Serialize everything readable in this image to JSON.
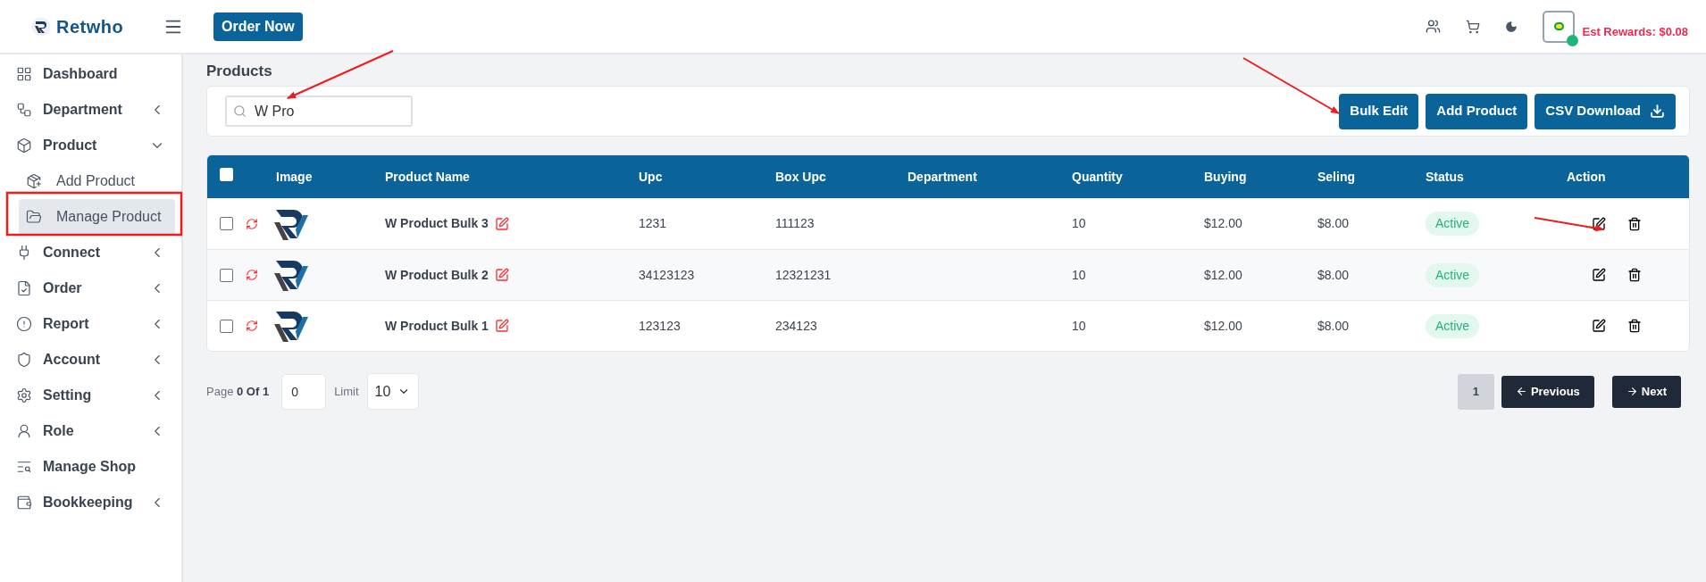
{
  "header": {
    "brand": "Retwho",
    "order_button": "Order Now",
    "rewards": "Est Rewards: $0.08",
    "online": true
  },
  "sidebar": {
    "items": [
      {
        "label": "Dashboard",
        "selected": false
      },
      {
        "label": "Department",
        "selected": false,
        "expanded": false
      },
      {
        "label": "Product",
        "selected": false,
        "expanded": true,
        "children": [
          {
            "label": "Add Product",
            "selected": false
          },
          {
            "label": "Manage Product",
            "selected": true
          }
        ]
      },
      {
        "label": "Connect",
        "selected": false,
        "expanded": false
      },
      {
        "label": "Order",
        "selected": false,
        "expanded": false
      },
      {
        "label": "Report",
        "selected": false,
        "expanded": false
      },
      {
        "label": "Account",
        "selected": false,
        "expanded": false
      },
      {
        "label": "Setting",
        "selected": false,
        "expanded": false
      },
      {
        "label": "Role",
        "selected": false,
        "expanded": false
      },
      {
        "label": "Manage Shop",
        "selected": false
      },
      {
        "label": "Bookkeeping",
        "selected": false,
        "expanded": false
      }
    ]
  },
  "page": {
    "title": "Products"
  },
  "toolbar": {
    "search": {
      "value": "W Pro"
    },
    "buttons": [
      "Bulk Edit",
      "Add Product",
      "CSV Download"
    ]
  },
  "table": {
    "header_checked": false,
    "columns": [
      "Image",
      "Product Name",
      "Upc",
      "Box Upc",
      "Department",
      "Quantity",
      "Buying",
      "Seling",
      "Status",
      "Action"
    ],
    "rows": [
      {
        "checked": false,
        "name": "W Product Bulk 3",
        "upc": "1231",
        "box_upc": "111123",
        "quantity": "10",
        "buying": "$12.00",
        "selling": "$8.00",
        "status": "Active"
      },
      {
        "checked": false,
        "name": "W Product Bulk 2",
        "upc": "34123123",
        "box_upc": "12321231",
        "quantity": "10",
        "buying": "$12.00",
        "selling": "$8.00",
        "status": "Active"
      },
      {
        "checked": false,
        "name": "W Product Bulk 1",
        "upc": "123123",
        "box_upc": "234123",
        "quantity": "10",
        "buying": "$12.00",
        "selling": "$8.00",
        "status": "Active"
      }
    ]
  },
  "pagination": {
    "page_label": "Page",
    "page_info": "0 Of 1",
    "page_input": "0",
    "limit_label": "Limit",
    "limit": "10",
    "pages": [
      "1"
    ],
    "previous": "Previous",
    "next": "Next"
  }
}
